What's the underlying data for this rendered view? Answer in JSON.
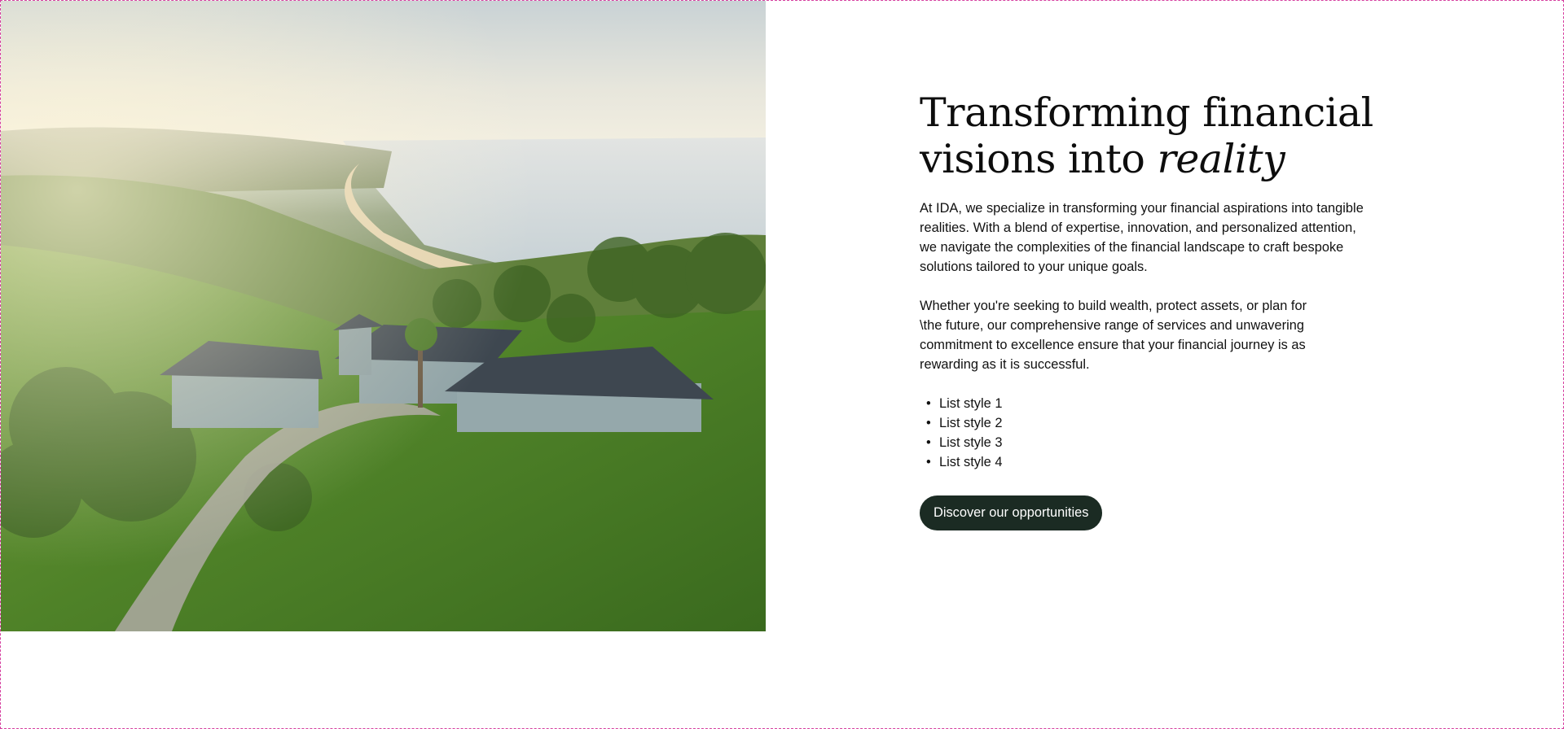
{
  "hero": {
    "image_alt": "Aerial view of a grey-roofed house on a green hillside above a beach and ocean"
  },
  "content": {
    "headline_line1": "Transforming financial",
    "headline_line2": "visions into ",
    "headline_italic": "reality",
    "paragraph1": "At IDA, we specialize in transforming your financial aspirations into tangible realities. With a blend of expertise, innovation, and personalized attention, we navigate the complexities of the financial landscape to craft bespoke solutions tailored to your unique goals.",
    "paragraph2": "Whether you're seeking to build wealth, protect assets, or plan for \\the future, our comprehensive range of services and unwavering commitment to excellence ensure that your financial journey is as rewarding as it is successful.",
    "list_items": [
      "List style 1",
      "List style 2",
      "List style 3",
      "List style 4"
    ],
    "button_label": "Discover our opportunities"
  },
  "colors": {
    "button_bg": "#1b2b23",
    "button_text": "#ffffff",
    "frame_border": "#d63fa0",
    "grass": "#4f7b2c",
    "roof": "#3e4750"
  }
}
